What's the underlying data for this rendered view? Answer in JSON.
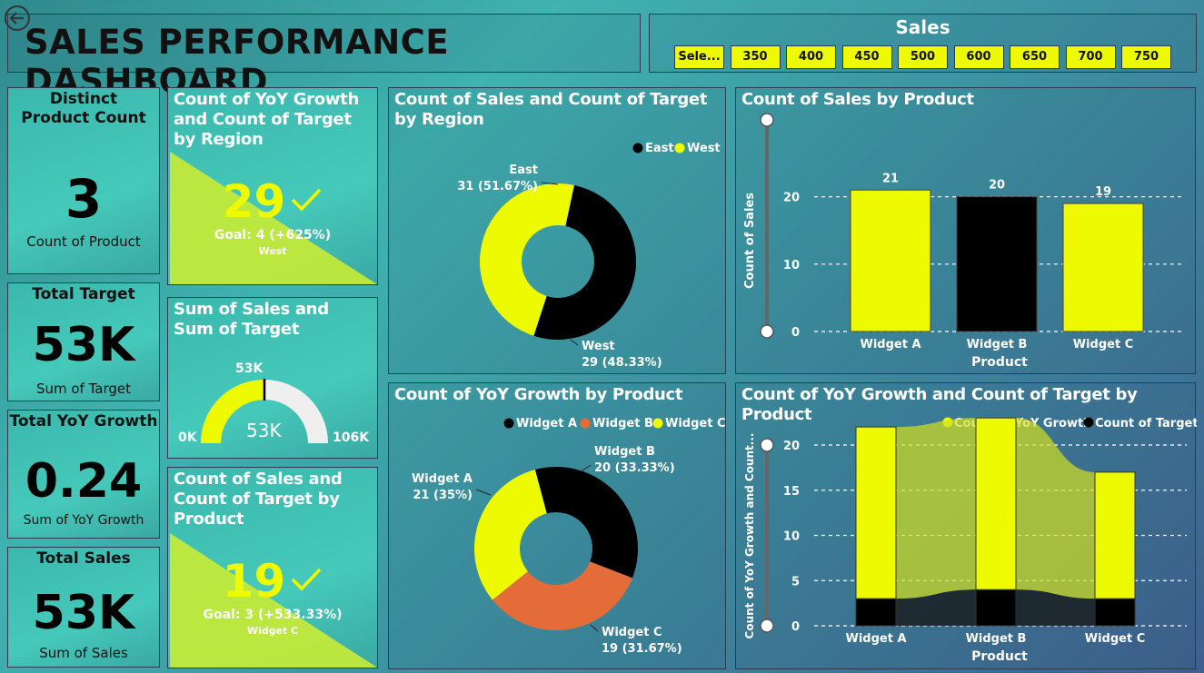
{
  "header": {
    "title": "SALES PERFORMANCE DASHBOARD",
    "back_icon": "back-arrow-icon"
  },
  "slicer": {
    "title": "Sales",
    "options": [
      "Sele...",
      "350",
      "400",
      "450",
      "500",
      "600",
      "650",
      "700",
      "750"
    ]
  },
  "kpis": {
    "distinct_product": {
      "title": "Distinct Product Count",
      "value": "3",
      "sub": "Count of Product"
    },
    "total_target": {
      "title": "Total Target",
      "value": "53K",
      "sub": "Sum of Target"
    },
    "total_yoy": {
      "title": "Total YoY Growth",
      "value": "0.24",
      "sub": "Sum of YoY Growth"
    },
    "total_sales": {
      "title": "Total Sales",
      "value": "53K",
      "sub": "Sum of Sales"
    }
  },
  "kpi_region": {
    "title": "Count of YoY Growth and Count of Target by Region",
    "value": "29",
    "goal": "Goal: 4 (+625%)",
    "category": "West",
    "check_icon": "check-icon"
  },
  "gauge": {
    "title": "Sum of Sales and Sum of Target",
    "value_label": "53K",
    "target_label": "53K",
    "min_label": "0K",
    "max_label": "106K",
    "value": 53,
    "max": 106
  },
  "kpi_product": {
    "title": "Count of Sales and Count of Target by Product",
    "value": "19",
    "goal": "Goal: 3 (+533.33%)",
    "category": "Widget C",
    "check_icon": "check-icon"
  },
  "donut_region": {
    "title": "Count of Sales and Count of Target by Region",
    "legend": [
      {
        "name": "East",
        "color": "#000000"
      },
      {
        "name": "West",
        "color": "#eefa00"
      }
    ],
    "labels": [
      {
        "name": "East",
        "detail": "31 (51.67%)"
      },
      {
        "name": "West",
        "detail": "29 (48.33%)"
      }
    ]
  },
  "donut_product": {
    "title": "Count of YoY Growth by Product",
    "legend": [
      {
        "name": "Widget A",
        "color": "#000000"
      },
      {
        "name": "Widget B",
        "color": "#e46c39"
      },
      {
        "name": "Widget C",
        "color": "#eefa00"
      }
    ],
    "labels": [
      {
        "name": "Widget A",
        "detail": "21 (35%)"
      },
      {
        "name": "Widget B",
        "detail": "20 (33.33%)"
      },
      {
        "name": "Widget C",
        "detail": "19 (31.67%)"
      }
    ]
  },
  "bar_sales": {
    "title": "Count of Sales by Product",
    "xlabel": "Product",
    "ylabel": "Count of Sales",
    "yticks": [
      "0",
      "10",
      "20"
    ]
  },
  "bar_yoy": {
    "title": "Count of YoY Growth and Count of Target by Product",
    "xlabel": "Product",
    "ylabel": "Count of YoY Growth and Count...",
    "legend": [
      "Count of YoY Growth",
      "Count of Target"
    ],
    "yticks": [
      "0",
      "5",
      "10",
      "15",
      "20"
    ]
  },
  "chart_data": [
    {
      "type": "pie",
      "title": "Count of Sales and Count of Target by Region",
      "categories": [
        "East",
        "West"
      ],
      "values": [
        31,
        29
      ],
      "colors": [
        "#000000",
        "#eefa00"
      ]
    },
    {
      "type": "pie",
      "title": "Count of YoY Growth by Product",
      "categories": [
        "Widget A",
        "Widget B",
        "Widget C"
      ],
      "values": [
        21,
        20,
        19
      ],
      "colors": [
        "#000000",
        "#e46c39",
        "#eefa00"
      ]
    },
    {
      "type": "bar",
      "title": "Count of Sales by Product",
      "categories": [
        "Widget A",
        "Widget B",
        "Widget C"
      ],
      "values": [
        21,
        20,
        19
      ],
      "colors": [
        "#eefa00",
        "#000000",
        "#eefa00"
      ],
      "xlabel": "Product",
      "ylabel": "Count of Sales",
      "ylim": [
        0,
        24
      ]
    },
    {
      "type": "bar",
      "title": "Count of YoY Growth and Count of Target by Product",
      "categories": [
        "Widget A",
        "Widget B",
        "Widget C"
      ],
      "series": [
        {
          "name": "Count of YoY Growth",
          "values": [
            19,
            19,
            14
          ],
          "color": "#eefa00"
        },
        {
          "name": "Count of Target",
          "values": [
            3,
            4,
            3
          ],
          "color": "#000000"
        }
      ],
      "stacked": true,
      "xlabel": "Product",
      "ylabel": "Count of YoY Growth and Count...",
      "ylim": [
        0,
        20
      ]
    }
  ]
}
